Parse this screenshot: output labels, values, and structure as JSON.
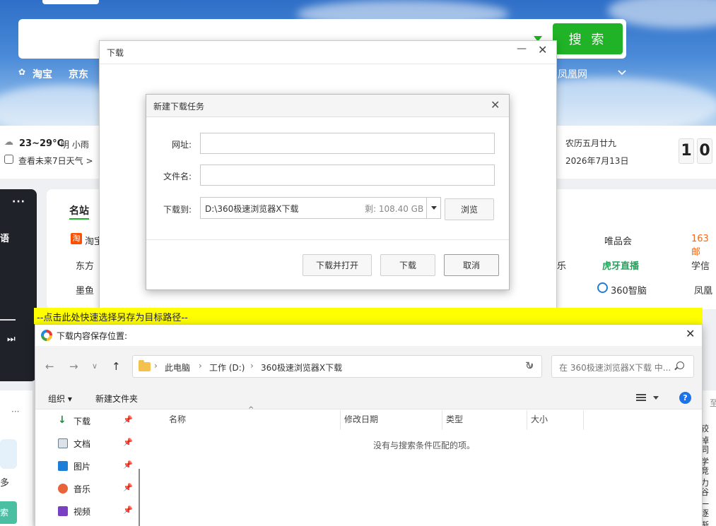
{
  "browser": {
    "search_button": "搜 索",
    "nav_links": [
      "淘宝",
      "京东",
      "凤凰网"
    ],
    "weather": {
      "temp": "23~29°C",
      "desc": "明 小雨",
      "link": "查看未来7日天气 >"
    },
    "calendar": {
      "lunar": "农历五月廿九",
      "date": "2026年7月13日",
      "clock_digits": [
        "1",
        "0"
      ]
    },
    "left_panel": {
      "dots": "···",
      "text": "语",
      "more": "多",
      "button": "索"
    },
    "sites": {
      "title": "名站",
      "items": [
        "淘宝",
        "东方",
        "墨鱼",
        "唯品会",
        "163邮",
        "虎牙直播",
        "学信",
        "360智脑",
        "凤凰",
        "乐"
      ]
    },
    "right_list": [
      "较掉",
      "同学",
      "竞力",
      "谷一",
      "逐渐",
      "至"
    ]
  },
  "download_window": {
    "title": "下载",
    "minimize": "—",
    "close": "✕"
  },
  "new_task": {
    "title": "新建下载任务",
    "close": "✕",
    "url_label": "网址:",
    "url_value": "",
    "filename_label": "文件名:",
    "filename_value": "",
    "saveto_label": "下载到:",
    "path": "D:\\360极速浏览器X下载",
    "free_space": "剩: 108.40 GB",
    "browse_button": "浏览",
    "download_open_button": "下载并打开",
    "download_button": "下载",
    "cancel_button": "取消"
  },
  "hint_bar": "--点击此处快速选择另存为目标路径--",
  "save_dialog": {
    "title": "下载内容保存位置:",
    "close": "✕",
    "breadcrumbs": [
      "此电脑",
      "工作 (D:)",
      "360极速浏览器X下载"
    ],
    "search_placeholder": "在 360极速浏览器X下载 中...",
    "toolbar": {
      "organize": "组织 ▾",
      "new_folder": "新建文件夹"
    },
    "sidebar": [
      {
        "label": "下载",
        "icon": "download-icon",
        "color": "#1a8f3c"
      },
      {
        "label": "文档",
        "icon": "document-icon",
        "color": "#6b7c93"
      },
      {
        "label": "图片",
        "icon": "picture-icon",
        "color": "#1c7ed6"
      },
      {
        "label": "音乐",
        "icon": "music-icon",
        "color": "#e8643a"
      },
      {
        "label": "视频",
        "icon": "video-icon",
        "color": "#7b3fc4"
      }
    ],
    "columns": [
      "名称",
      "修改日期",
      "类型",
      "大小"
    ],
    "empty_message": "没有与搜索条件匹配的项。"
  }
}
